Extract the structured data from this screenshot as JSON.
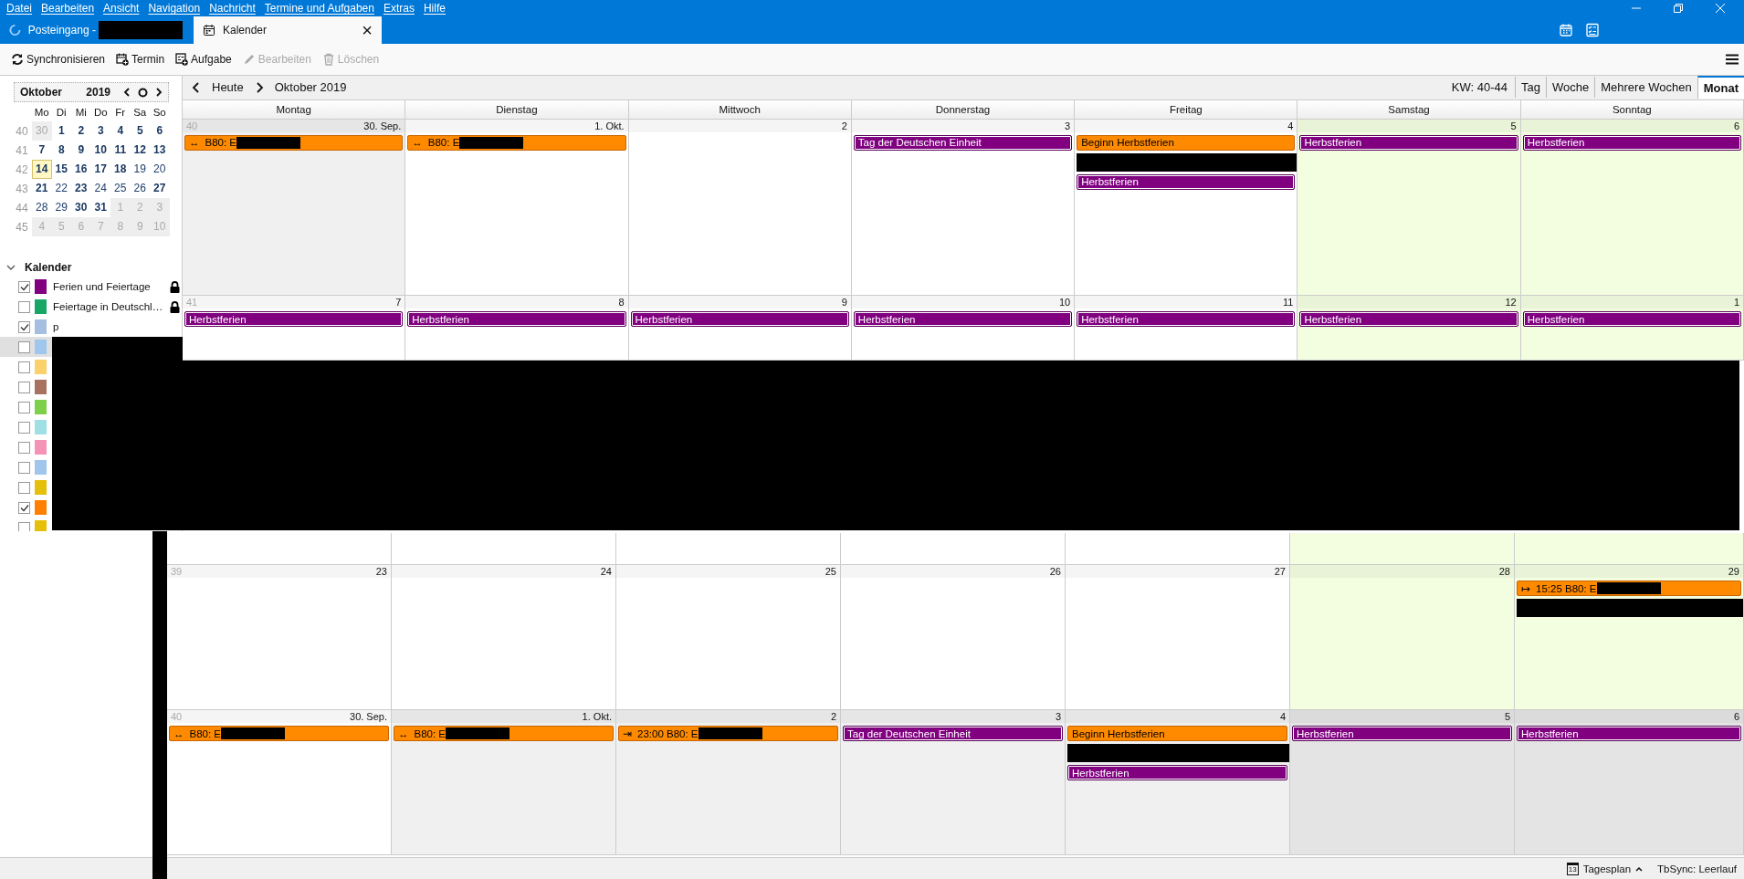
{
  "menu": [
    "Datei",
    "Bearbeiten",
    "Ansicht",
    "Navigation",
    "Nachricht",
    "Termine und Aufgaben",
    "Extras",
    "Hilfe"
  ],
  "tabs": [
    {
      "label": "Posteingang - ",
      "kind": "mail",
      "selected": false,
      "redacted": true
    },
    {
      "label": "Kalender",
      "kind": "calendar",
      "selected": true,
      "redacted": false,
      "close": "×"
    }
  ],
  "toolbar": [
    {
      "label": "Synchronisieren",
      "kind": "sync",
      "disabled": false
    },
    {
      "label": "Termin",
      "kind": "event",
      "disabled": false
    },
    {
      "label": "Aufgabe",
      "kind": "task",
      "disabled": false
    },
    {
      "label": "Bearbeiten",
      "kind": "edit",
      "disabled": true
    },
    {
      "label": "Löschen",
      "kind": "delete",
      "disabled": true
    }
  ],
  "minical": {
    "month": "Oktober",
    "year": "2019",
    "weekdays": [
      "Mo",
      "Di",
      "Mi",
      "Do",
      "Fr",
      "Sa",
      "So"
    ],
    "weeks": [
      {
        "week": "40",
        "days": [
          {
            "label": "30",
            "outside": true,
            "busy": false,
            "today": false
          },
          {
            "label": "1",
            "outside": false,
            "busy": true,
            "today": false
          },
          {
            "label": "2",
            "outside": false,
            "busy": true,
            "today": false
          },
          {
            "label": "3",
            "outside": false,
            "busy": true,
            "today": false
          },
          {
            "label": "4",
            "outside": false,
            "busy": true,
            "today": false
          },
          {
            "label": "5",
            "outside": false,
            "busy": true,
            "today": false
          },
          {
            "label": "6",
            "outside": false,
            "busy": true,
            "today": false
          }
        ]
      },
      {
        "week": "41",
        "days": [
          {
            "label": "7",
            "outside": false,
            "busy": true,
            "today": false
          },
          {
            "label": "8",
            "outside": false,
            "busy": true,
            "today": false
          },
          {
            "label": "9",
            "outside": false,
            "busy": true,
            "today": false
          },
          {
            "label": "10",
            "outside": false,
            "busy": true,
            "today": false
          },
          {
            "label": "11",
            "outside": false,
            "busy": true,
            "today": false
          },
          {
            "label": "12",
            "outside": false,
            "busy": true,
            "today": false
          },
          {
            "label": "13",
            "outside": false,
            "busy": true,
            "today": false
          }
        ]
      },
      {
        "week": "42",
        "days": [
          {
            "label": "14",
            "outside": false,
            "busy": true,
            "today": true
          },
          {
            "label": "15",
            "outside": false,
            "busy": true,
            "today": false
          },
          {
            "label": "16",
            "outside": false,
            "busy": true,
            "today": false
          },
          {
            "label": "17",
            "outside": false,
            "busy": true,
            "today": false
          },
          {
            "label": "18",
            "outside": false,
            "busy": true,
            "today": false
          },
          {
            "label": "19",
            "outside": false,
            "busy": false,
            "today": false
          },
          {
            "label": "20",
            "outside": false,
            "busy": false,
            "today": false
          }
        ]
      },
      {
        "week": "43",
        "days": [
          {
            "label": "21",
            "outside": false,
            "busy": true,
            "today": false
          },
          {
            "label": "22",
            "outside": false,
            "busy": false,
            "today": false
          },
          {
            "label": "23",
            "outside": false,
            "busy": true,
            "today": false
          },
          {
            "label": "24",
            "outside": false,
            "busy": false,
            "today": false
          },
          {
            "label": "25",
            "outside": false,
            "busy": false,
            "today": false
          },
          {
            "label": "26",
            "outside": false,
            "busy": false,
            "today": false
          },
          {
            "label": "27",
            "outside": false,
            "busy": true,
            "today": false
          }
        ]
      },
      {
        "week": "44",
        "days": [
          {
            "label": "28",
            "outside": false,
            "busy": false,
            "today": false
          },
          {
            "label": "29",
            "outside": false,
            "busy": false,
            "today": false
          },
          {
            "label": "30",
            "outside": false,
            "busy": true,
            "today": false
          },
          {
            "label": "31",
            "outside": false,
            "busy": true,
            "today": false
          },
          {
            "label": "1",
            "outside": true,
            "busy": false,
            "today": false
          },
          {
            "label": "2",
            "outside": true,
            "busy": false,
            "today": false
          },
          {
            "label": "3",
            "outside": true,
            "busy": false,
            "today": false
          }
        ]
      },
      {
        "week": "45",
        "days": [
          {
            "label": "4",
            "outside": true,
            "busy": false,
            "today": false
          },
          {
            "label": "5",
            "outside": true,
            "busy": false,
            "today": false
          },
          {
            "label": "6",
            "outside": true,
            "busy": false,
            "today": false
          },
          {
            "label": "7",
            "outside": true,
            "busy": false,
            "today": false
          },
          {
            "label": "8",
            "outside": true,
            "busy": false,
            "today": false
          },
          {
            "label": "9",
            "outside": true,
            "busy": false,
            "today": false
          },
          {
            "label": "10",
            "outside": true,
            "busy": false,
            "today": false
          }
        ]
      }
    ]
  },
  "calendars": {
    "title": "Kalender",
    "expanded": true,
    "items": [
      {
        "name": "Ferien und Feiertage",
        "checked": true,
        "color": "#800080",
        "locked": true
      },
      {
        "name": "Feiertage in Deutschl…",
        "checked": false,
        "color": "#18a566",
        "locked": true
      },
      {
        "name": "p",
        "checked": true,
        "color": "#a6bfe0",
        "locked": false
      },
      {
        "checked": false,
        "color": "#9fc6ec",
        "selected": true
      },
      {
        "checked": false,
        "color": "#fbd26a",
        "selected": false
      },
      {
        "checked": false,
        "color": "#a87160",
        "selected": false
      },
      {
        "checked": false,
        "color": "#7ed04a",
        "selected": false
      },
      {
        "checked": false,
        "color": "#a0e0e5",
        "selected": false
      },
      {
        "checked": false,
        "color": "#f493b6",
        "selected": false
      },
      {
        "checked": false,
        "color": "#a0c6ec",
        "selected": false
      },
      {
        "checked": false,
        "color": "#e6bf0a",
        "selected": false
      },
      {
        "checked": true,
        "color": "#ff8000",
        "selected": false
      },
      {
        "checked": false,
        "color": "#e6bf0a",
        "selected": false
      }
    ]
  },
  "nav": {
    "today": "Heute",
    "title": "Oktober 2019",
    "week_range": "KW: 40-44",
    "views": [
      {
        "label": "Tag",
        "selected": false
      },
      {
        "label": "Woche",
        "selected": false
      },
      {
        "label": "Mehrere Wochen",
        "selected": false
      },
      {
        "label": "Monat",
        "selected": true
      }
    ]
  },
  "weekday_headers": [
    "Montag",
    "Dienstag",
    "Mittwoch",
    "Donnerstag",
    "Freitag",
    "Samstag",
    "Sonntag"
  ],
  "upper_weeks": [
    {
      "days": [
        {
          "week": "40",
          "label": "30. Sep.",
          "weekend": false,
          "dimmed": true,
          "events": [
            {
              "kind": "bar",
              "mark": "↔",
              "title": "B80: E",
              "color": "#ff8a00",
              "redacted": true
            }
          ]
        },
        {
          "label": "1. Okt.",
          "weekend": false,
          "dimmed": false,
          "events": [
            {
              "kind": "bar",
              "mark": "↔",
              "title": "B80: E",
              "color": "#ff8a00",
              "redacted": true
            }
          ]
        },
        {
          "label": "2",
          "weekend": false,
          "dimmed": false
        },
        {
          "label": "3",
          "weekend": false,
          "dimmed": false,
          "events": [
            {
              "kind": "bar",
              "title": "Tag der Deutschen Einheit",
              "color": "#800080",
              "redacted": false
            }
          ]
        },
        {
          "label": "4",
          "weekend": false,
          "dimmed": false,
          "events": [
            {
              "kind": "bar",
              "title": "Beginn Herbstferien",
              "color": "#ff8a00",
              "redacted": false
            },
            {
              "kind": "hidden"
            },
            {
              "kind": "bar",
              "title": "Herbstferien",
              "color": "#800080",
              "redacted": false
            }
          ]
        },
        {
          "label": "5",
          "weekend": true,
          "dimmed": false,
          "events": [
            {
              "kind": "bar",
              "title": "Herbstferien",
              "color": "#800080",
              "redacted": false
            }
          ]
        },
        {
          "label": "6",
          "weekend": true,
          "dimmed": false,
          "events": [
            {
              "kind": "bar",
              "title": "Herbstferien",
              "color": "#800080",
              "redacted": false
            }
          ]
        }
      ]
    },
    {
      "days": [
        {
          "week": "41",
          "label": "7",
          "weekend": false,
          "dimmed": false,
          "events": [
            {
              "kind": "bar",
              "title": "Herbstferien",
              "color": "#800080",
              "redacted": false
            }
          ]
        },
        {
          "label": "8",
          "weekend": false,
          "dimmed": false,
          "events": [
            {
              "kind": "bar",
              "title": "Herbstferien",
              "color": "#800080",
              "redacted": false
            }
          ]
        },
        {
          "label": "9",
          "weekend": false,
          "dimmed": false,
          "events": [
            {
              "kind": "bar",
              "title": "Herbstferien",
              "color": "#800080",
              "redacted": false
            }
          ]
        },
        {
          "label": "10",
          "weekend": false,
          "dimmed": false,
          "events": [
            {
              "kind": "bar",
              "title": "Herbstferien",
              "color": "#800080",
              "redacted": false
            }
          ]
        },
        {
          "label": "11",
          "weekend": false,
          "dimmed": false,
          "events": [
            {
              "kind": "bar",
              "title": "Herbstferien",
              "color": "#800080",
              "redacted": false
            }
          ]
        },
        {
          "label": "12",
          "weekend": true,
          "dimmed": false,
          "events": [
            {
              "kind": "bar",
              "title": "Herbstferien",
              "color": "#800080",
              "redacted": false
            }
          ]
        },
        {
          "label": "1",
          "weekend": true,
          "dimmed": false,
          "events": [
            {
              "kind": "bar",
              "title": "Herbstferien",
              "color": "#800080",
              "redacted": false
            }
          ]
        }
      ]
    }
  ],
  "lower_weeks": [
    {
      "days": [
        {
          "weekend": false,
          "dimmed": false
        },
        {
          "weekend": false,
          "dimmed": false
        },
        {
          "weekend": false,
          "dimmed": false
        },
        {
          "weekend": false,
          "dimmed": false
        },
        {
          "weekend": false,
          "dimmed": false
        },
        {
          "weekend": true,
          "dimmed": false
        },
        {
          "weekend": true,
          "dimmed": false
        }
      ]
    },
    {
      "days": [
        {
          "week": "39",
          "label": "23",
          "weekend": false,
          "dimmed": false
        },
        {
          "label": "24",
          "weekend": false,
          "dimmed": false
        },
        {
          "label": "25",
          "weekend": false,
          "dimmed": false
        },
        {
          "label": "26",
          "weekend": false,
          "dimmed": false
        },
        {
          "label": "27",
          "weekend": false,
          "dimmed": false
        },
        {
          "label": "28",
          "weekend": true,
          "dimmed": false
        },
        {
          "label": "29",
          "weekend": true,
          "dimmed": false,
          "events": [
            {
              "kind": "bar",
              "mark": "↦",
              "title": "15:25 B80: E",
              "color": "#ff8a00",
              "redacted": true
            },
            {
              "kind": "hidden"
            }
          ]
        }
      ]
    },
    {
      "days": [
        {
          "week": "40",
          "label": "30. Sep.",
          "weekend": false,
          "dimmed": false,
          "events": [
            {
              "kind": "bar",
              "mark": "↔",
              "title": "B80: E",
              "color": "#ff8a00",
              "redacted": true
            }
          ]
        },
        {
          "label": "1. Okt.",
          "weekend": false,
          "dimmed": true,
          "events": [
            {
              "kind": "bar",
              "mark": "↔",
              "title": "B80: E",
              "color": "#ff8a00",
              "redacted": true
            }
          ]
        },
        {
          "label": "2",
          "weekend": false,
          "dimmed": true,
          "events": [
            {
              "kind": "bar",
              "mark": "⇥",
              "title": "23:00 B80: E",
              "color": "#ff8a00",
              "redacted": true
            }
          ]
        },
        {
          "label": "3",
          "weekend": false,
          "dimmed": true,
          "events": [
            {
              "kind": "bar",
              "title": "Tag der Deutschen Einheit",
              "color": "#800080",
              "redacted": false
            }
          ]
        },
        {
          "label": "4",
          "weekend": false,
          "dimmed": true,
          "events": [
            {
              "kind": "bar",
              "title": "Beginn Herbstferien",
              "color": "#ff8a00",
              "redacted": false
            },
            {
              "kind": "hidden"
            },
            {
              "kind": "bar",
              "title": "Herbstferien",
              "color": "#800080",
              "redacted": false
            }
          ]
        },
        {
          "label": "5",
          "weekend": true,
          "dimmed": true,
          "events": [
            {
              "kind": "bar",
              "title": "Herbstferien",
              "color": "#800080",
              "redacted": false
            }
          ]
        },
        {
          "label": "6",
          "weekend": true,
          "dimmed": true,
          "events": [
            {
              "kind": "bar",
              "title": "Herbstferien",
              "color": "#800080",
              "redacted": false
            }
          ]
        }
      ]
    }
  ],
  "status": {
    "agenda": "Tagesplan",
    "agenda_icon_day": "13",
    "sync": "TbSync: Leerlauf"
  }
}
